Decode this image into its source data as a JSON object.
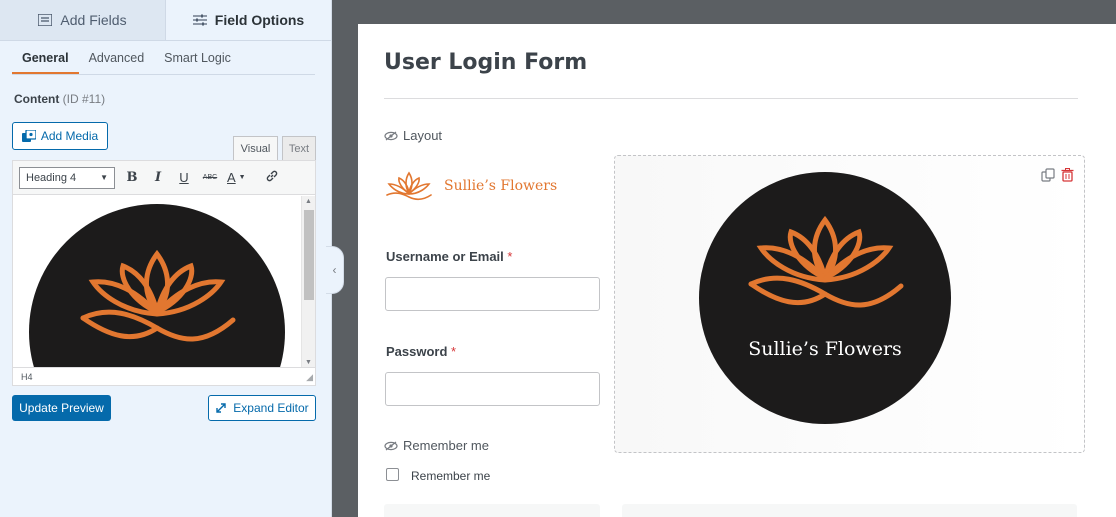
{
  "sidebar": {
    "top_tabs": [
      {
        "label": "Add Fields",
        "icon": "list-icon"
      },
      {
        "label": "Field Options",
        "icon": "sliders-icon"
      }
    ],
    "sub_tabs": [
      "General",
      "Advanced",
      "Smart Logic"
    ],
    "content_label": "Content",
    "content_id": "(ID #11)",
    "add_media_label": "Add Media",
    "editor_modes": [
      "Visual",
      "Text"
    ],
    "format_select": "Heading 4",
    "toolbar_buttons": {
      "bold": "B",
      "italic": "I",
      "underline": "U",
      "strike": "ABC",
      "color": "A"
    },
    "status_path": "H4",
    "update_preview_label": "Update Preview",
    "expand_editor_label": "Expand Editor"
  },
  "form": {
    "title": "User Login Form",
    "layout_label": "Layout",
    "brand_name": "Sullie’s Flowers",
    "username_label": "Username or Email",
    "password_label": "Password",
    "required_marker": "*",
    "remember_section_label": "Remember me",
    "remember_checkbox_label": "Remember me",
    "logo_text": "Sullie’s Flowers"
  },
  "colors": {
    "accent": "#e27730",
    "primary": "#056aab",
    "dark": "#1c1b1b"
  }
}
